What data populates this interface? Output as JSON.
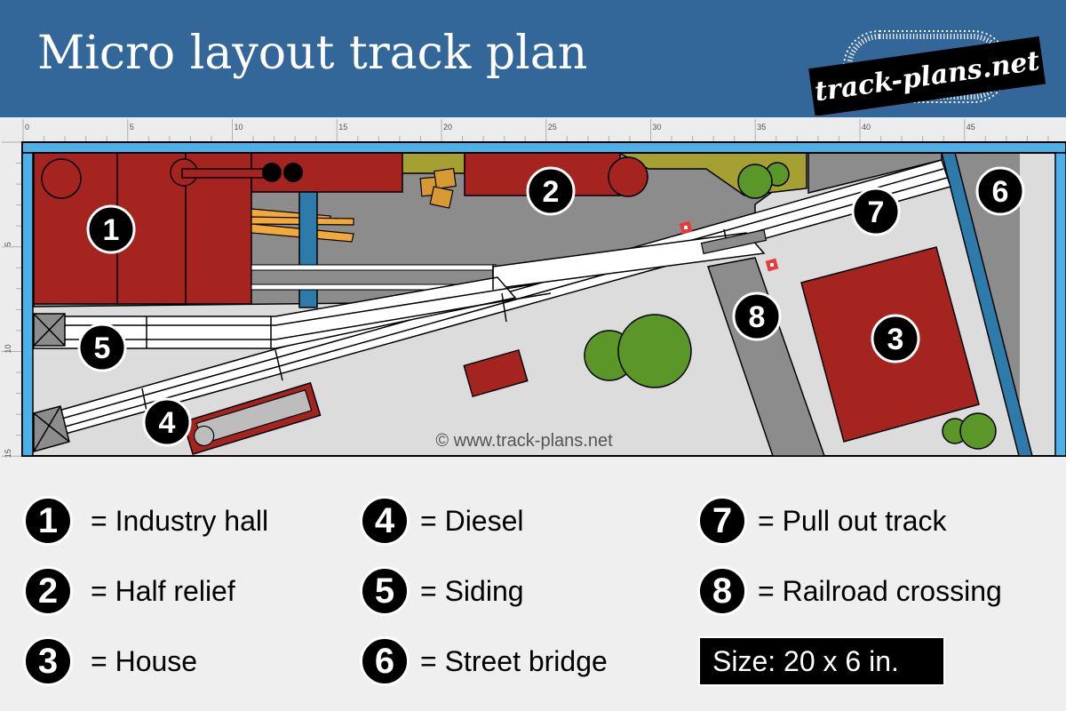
{
  "header": {
    "title": "Micro layout track plan",
    "logo_text": "track-plans.net",
    "background_color": "#336699"
  },
  "rulers": {
    "top_labels": [
      "0",
      "5",
      "10",
      "15",
      "20",
      "25",
      "30",
      "35",
      "40",
      "45"
    ],
    "left_labels": [
      "5",
      "10",
      "15"
    ]
  },
  "plan": {
    "copyright": "© www.track-plans.net",
    "markers": [
      "1",
      "2",
      "3",
      "4",
      "5",
      "6",
      "7",
      "8"
    ],
    "colors": {
      "backdrop_blue": "#4db0e8",
      "building_red": "#a52420",
      "ground_gray": "#8c8c8c",
      "light_ground": "#dcdcdc",
      "grass_olive": "#a6a032",
      "tree_green": "#5a9628",
      "bridge_blue": "#2c7bab",
      "crate_orange": "#d79a32",
      "lumber_orange": "#f2a93a",
      "signal_red": "#e83a3a"
    }
  },
  "legend": {
    "items": [
      {
        "num": "1",
        "label": "= Industry hall"
      },
      {
        "num": "2",
        "label": "= Half relief"
      },
      {
        "num": "3",
        "label": "= House"
      },
      {
        "num": "4",
        "label": "= Diesel"
      },
      {
        "num": "5",
        "label": "= Siding"
      },
      {
        "num": "6",
        "label": "= Street bridge"
      },
      {
        "num": "7",
        "label": "= Pull out track"
      },
      {
        "num": "8",
        "label": "= Railroad crossing"
      }
    ],
    "size_label": "Size: 20 x 6 in."
  }
}
